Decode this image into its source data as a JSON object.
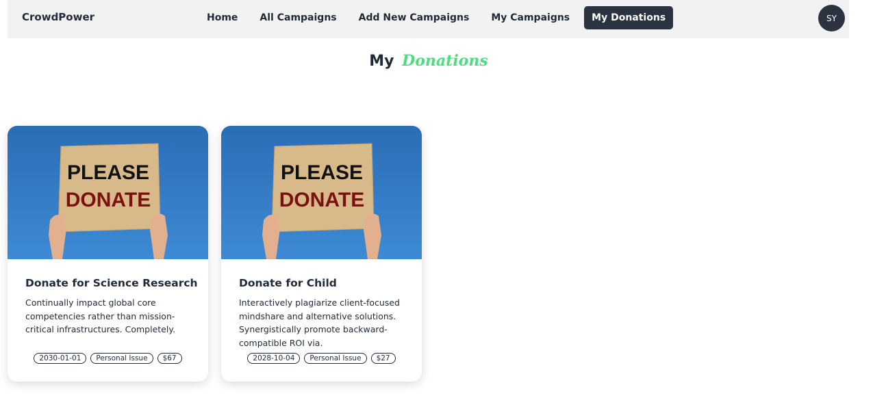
{
  "brand": "CrowdPower",
  "nav": [
    {
      "label": "Home",
      "active": false
    },
    {
      "label": "All Campaigns",
      "active": false
    },
    {
      "label": "Add New Campaigns",
      "active": false
    },
    {
      "label": "My Campaigns",
      "active": false
    },
    {
      "label": "My Donations",
      "active": true
    }
  ],
  "user": {
    "initials": "SY"
  },
  "title": {
    "first": "My",
    "accent": "Donations"
  },
  "image": {
    "line1": "PLEASE",
    "line2": "DONATE"
  },
  "cards": [
    {
      "title": "Donate for Science Research",
      "description": "Continually impact global core competencies rather than mission-critical infrastructures. Completely.",
      "date": "2030-01-01",
      "category": "Personal Issue",
      "amount": "$67"
    },
    {
      "title": "Donate for Child",
      "description": "Interactively plagiarize client-focused mindshare and alternative solutions. Synergistically promote backward-compatible ROI via.",
      "date": "2028-10-04",
      "category": "Personal Issue",
      "amount": "$27"
    }
  ],
  "colors": {
    "accent": "#4ade80",
    "dark": "#2b3240",
    "nav_bg": "#f2f2f2",
    "sky": "#2f78c4",
    "cardboard": "#d8b98a",
    "donate_red": "#7a1010"
  }
}
